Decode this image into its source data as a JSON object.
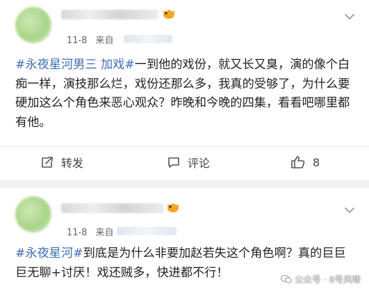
{
  "posts": [
    {
      "date": "11-8",
      "source_prefix": "来自",
      "content": {
        "tag": "#永夜星河男三 加戏#",
        "text": "一到他的戏份，就又长又臭，演的像个白痴一样，演技那么烂，戏份还那么多，我真的受够了，为什么要硬加这么个角色来恶心观众？昨晚和今晚的四集，看看吧哪里都有他。"
      },
      "actions": {
        "repost_label": "转发",
        "comment_label": "评论",
        "like_count": "8"
      }
    },
    {
      "date": "11-8",
      "source_prefix": "来自",
      "content": {
        "tag": "#永夜星河#",
        "text": "到底是为什么非要加赵若失这个角色啊？真的巨巨巨无聊+讨厌！戏还贼多，快进都不行！"
      }
    }
  ],
  "watermark": {
    "text": "公众号 · 8号风嘜"
  },
  "icons": {
    "badge": "puffer-fish-badge-icon",
    "more": "chevron-down-icon",
    "repost": "repost-icon",
    "comment": "comment-icon",
    "like": "thumbs-up-icon"
  },
  "colors": {
    "hashtag": "#3f6eb3",
    "badge": "#f5a623"
  }
}
